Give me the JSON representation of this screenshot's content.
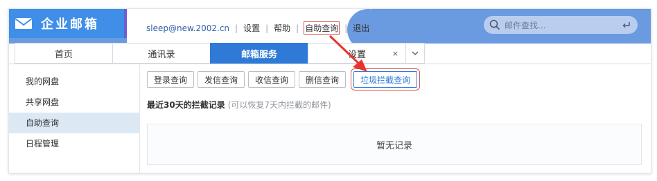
{
  "header": {
    "logo_text": "企业邮箱",
    "user_email": "sleep@new.2002.cn",
    "links": [
      {
        "label": "设置"
      },
      {
        "label": "帮助"
      },
      {
        "label": "自助查询"
      },
      {
        "label": "退出"
      }
    ],
    "search_placeholder": "邮件查找..."
  },
  "tabs": [
    {
      "label": "首页"
    },
    {
      "label": "通讯录"
    },
    {
      "label": "邮箱服务",
      "active": true
    },
    {
      "label": "设置",
      "closable": true
    }
  ],
  "tab_close_symbol": "×",
  "sidebar": {
    "items": [
      {
        "label": "我的网盘"
      },
      {
        "label": "共享网盘"
      },
      {
        "label": "自助查询",
        "active": true
      },
      {
        "label": "日程管理"
      }
    ]
  },
  "main": {
    "query_buttons": [
      {
        "label": "登录查询"
      },
      {
        "label": "发信查询"
      },
      {
        "label": "收信查询"
      },
      {
        "label": "删信查询"
      },
      {
        "label": "垃圾拦截查询",
        "active": true
      }
    ],
    "section_title": "最近30天的拦截记录",
    "section_hint": "(可以恢复7天内拦截的邮件)",
    "empty_text": "暂无记录"
  },
  "colors": {
    "accent": "#2f7ad6",
    "header_blue": "#6a9ae0",
    "annotation_red": "#d9534f"
  }
}
